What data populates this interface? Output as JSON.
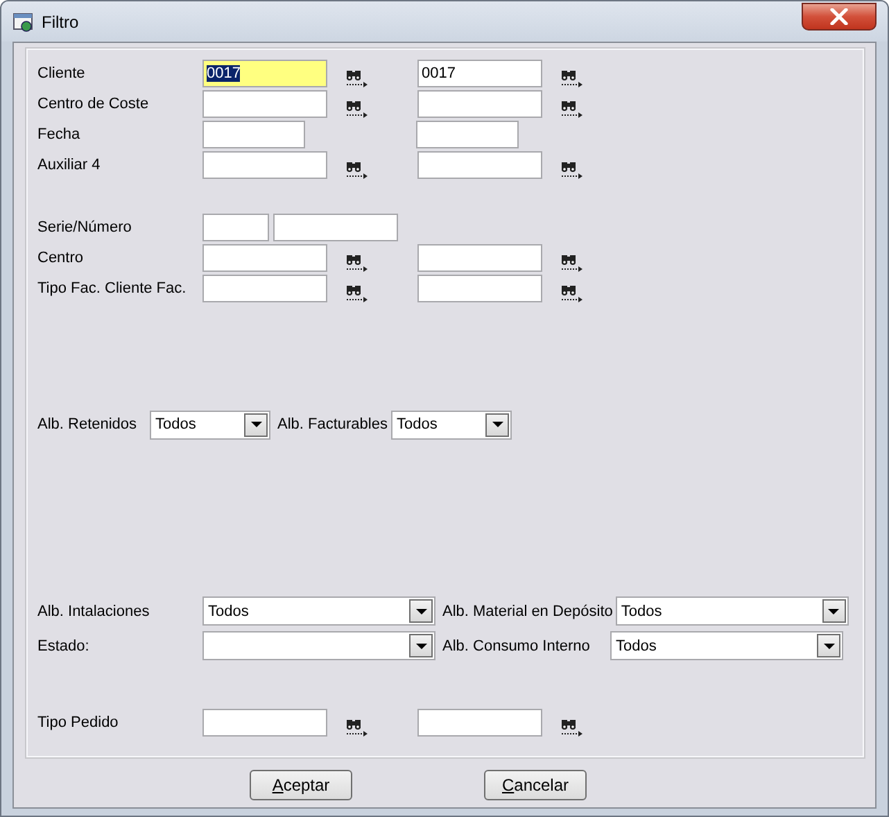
{
  "window": {
    "title": "Filtro"
  },
  "groups": [
    [
      {
        "items": [
          {
            "kind": "label",
            "text": "Cliente"
          },
          {
            "kind": "field",
            "value": "0017",
            "focused": true
          },
          {
            "kind": "search"
          },
          {
            "kind": "field",
            "value": "0017",
            "focused": false
          },
          {
            "kind": "search"
          }
        ]
      },
      {
        "items": [
          {
            "kind": "label",
            "text": "Centro de Coste"
          },
          {
            "kind": "field",
            "focused": false
          },
          {
            "kind": "search"
          },
          {
            "kind": "field",
            "focused": false
          },
          {
            "kind": "search"
          }
        ]
      },
      {
        "items": [
          {
            "kind": "label",
            "text": "Fecha"
          },
          {
            "kind": "short-field",
            "focused": false
          },
          {
            "kind": "gap"
          },
          {
            "kind": "short-field",
            "focused": false
          }
        ]
      },
      {
        "items": [
          {
            "kind": "label",
            "text": "Auxiliar 4"
          },
          {
            "kind": "field",
            "focused": false
          },
          {
            "kind": "search"
          },
          {
            "kind": "field",
            "focused": false
          },
          {
            "kind": "search"
          }
        ]
      }
    ],
    [
      {
        "items": [
          {
            "kind": "label",
            "text": "Serie/Número"
          },
          {
            "kind": "tiny-field",
            "focused": false
          },
          {
            "kind": "field",
            "focused": false
          }
        ]
      },
      {
        "items": [
          {
            "kind": "label",
            "text": "Centro"
          },
          {
            "kind": "field",
            "focused": false
          },
          {
            "kind": "search"
          },
          {
            "kind": "field",
            "focused": false
          },
          {
            "kind": "search"
          }
        ]
      },
      {
        "items": [
          {
            "kind": "label",
            "text": "Tipo Fac. Cliente Fac."
          },
          {
            "kind": "field",
            "focused": false
          },
          {
            "kind": "search"
          },
          {
            "kind": "field",
            "focused": false
          },
          {
            "kind": "search"
          }
        ]
      }
    ],
    [
      {
        "items": [
          {
            "kind": "label",
            "text": "Alb. Retenidos"
          },
          {
            "kind": "select",
            "value": "Todos"
          },
          {
            "kind": "label",
            "text": "Alb. Facturables"
          },
          {
            "kind": "select",
            "value": "Todos"
          }
        ]
      }
    ],
    [
      {
        "items": [
          {
            "kind": "label",
            "text": "Alb. Intalaciones"
          },
          {
            "kind": "select",
            "value": "Todos"
          },
          {
            "kind": "label",
            "text": "Alb. Material en Depósito"
          },
          {
            "kind": "select",
            "value": "Todos"
          }
        ]
      },
      {
        "items": [
          {
            "kind": "label",
            "text": "Estado:"
          },
          {
            "kind": "select"
          },
          {
            "kind": "label",
            "text": "Alb. Consumo Interno"
          },
          {
            "kind": "select",
            "value": "Todos"
          }
        ]
      }
    ],
    [
      {
        "items": [
          {
            "kind": "label",
            "text": "Tipo Pedido"
          },
          {
            "kind": "field",
            "focused": false
          },
          {
            "kind": "search"
          },
          {
            "kind": "field",
            "focused": false
          },
          {
            "kind": "search"
          }
        ]
      }
    ]
  ],
  "buttons": [
    "Aceptar",
    "Cancelar"
  ]
}
